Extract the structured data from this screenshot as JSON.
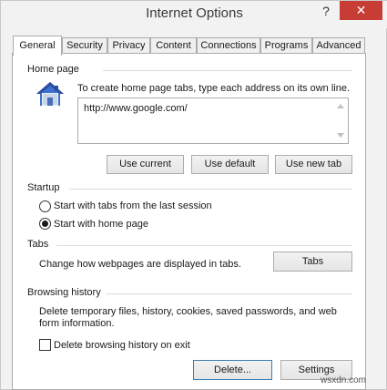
{
  "window": {
    "title": "Internet Options",
    "help_glyph": "?",
    "close_glyph": "✕"
  },
  "tabs": [
    {
      "label": "General",
      "active": true
    },
    {
      "label": "Security"
    },
    {
      "label": "Privacy"
    },
    {
      "label": "Content"
    },
    {
      "label": "Connections"
    },
    {
      "label": "Programs"
    },
    {
      "label": "Advanced"
    }
  ],
  "home_page": {
    "group_label": "Home page",
    "icon": "house-icon",
    "instructions": "To create home page tabs, type each address on its own line.",
    "address_value": "http://www.google.com/",
    "buttons": {
      "use_current": "Use current",
      "use_default": "Use default",
      "use_new_tab": "Use new tab"
    }
  },
  "startup": {
    "group_label": "Startup",
    "option_last_session": "Start with tabs from the last session",
    "option_home_page": "Start with home page",
    "selected": "home_page"
  },
  "tabs_group": {
    "group_label": "Tabs",
    "description": "Change how webpages are displayed in tabs.",
    "button": "Tabs"
  },
  "browsing_history": {
    "group_label": "Browsing history",
    "description_line1": "Delete temporary files, history, cookies, saved passwords, and web",
    "description_line2": "form information.",
    "checkbox_label": "Delete browsing history on exit",
    "checkbox_checked": false,
    "delete_button": "Delete...",
    "settings_button": "Settings"
  },
  "watermark": "wsxdn.com",
  "colors": {
    "close_button": "#c73c35",
    "focus_border": "#3c7fb1",
    "group_line": "#d5dfe5"
  }
}
